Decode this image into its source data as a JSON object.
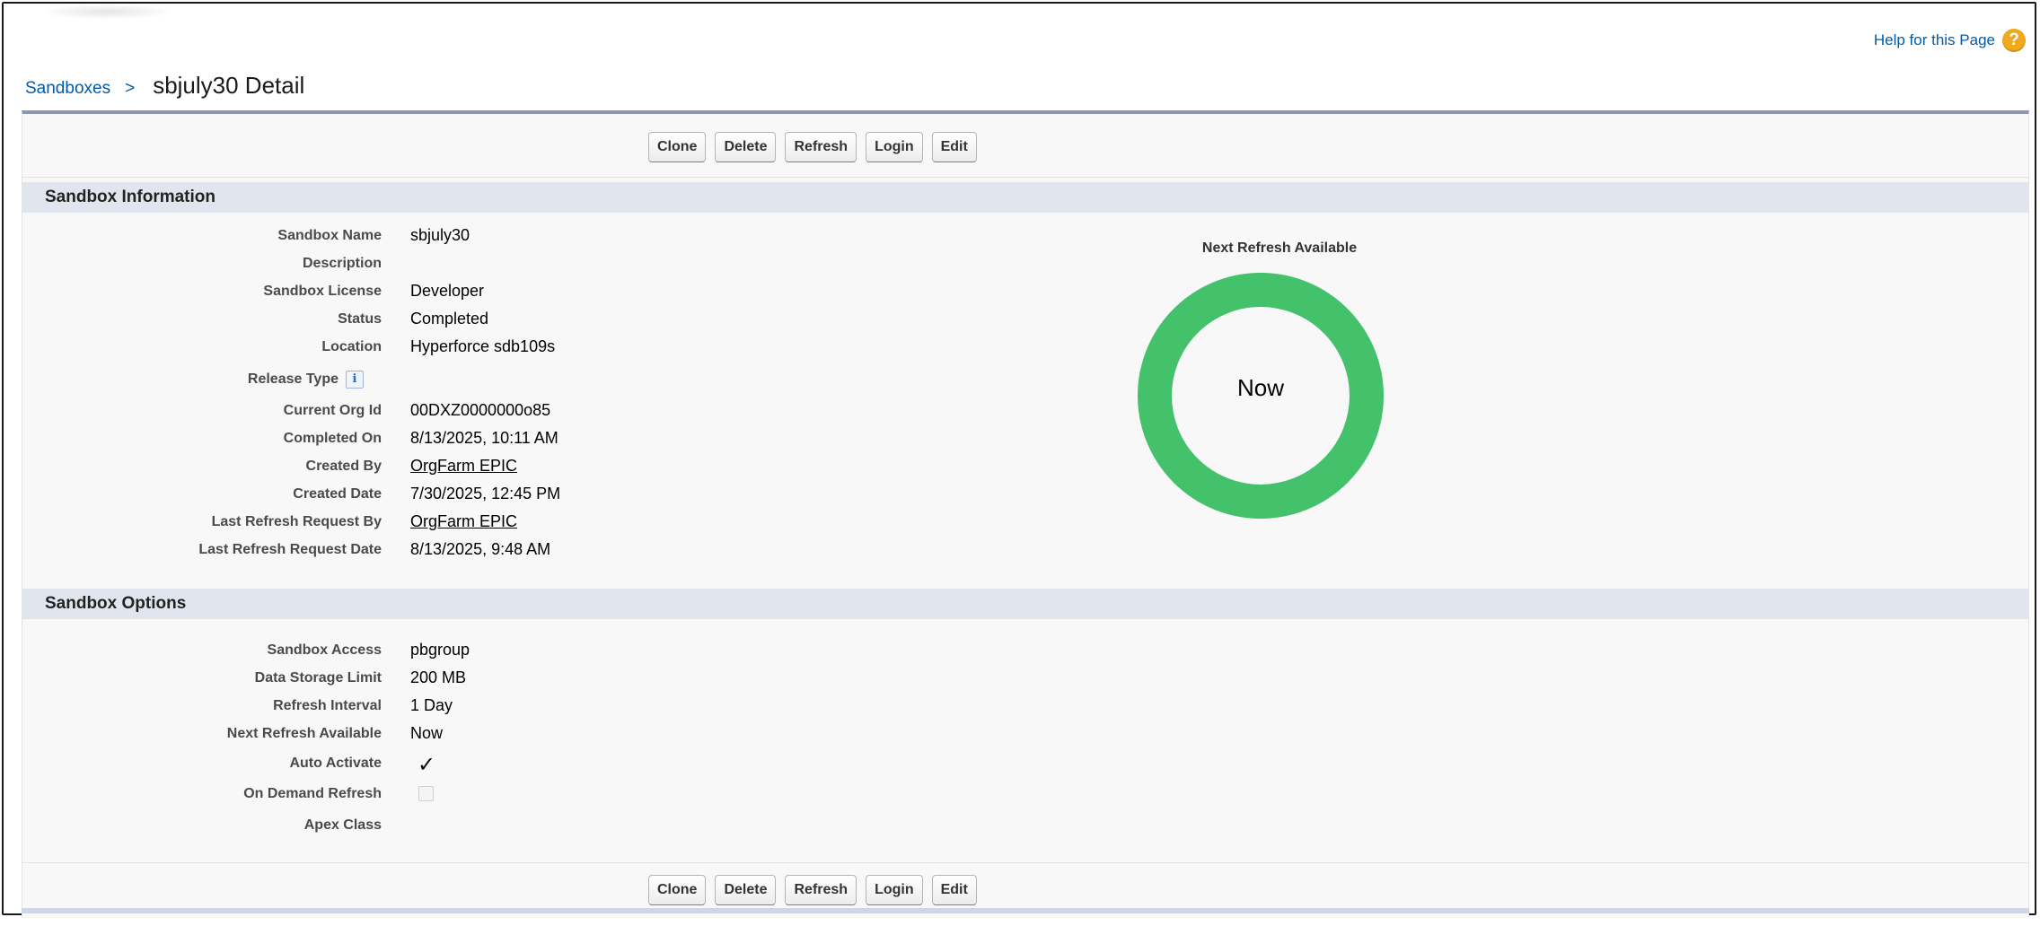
{
  "header": {
    "help_label": "Help for this Page",
    "help_icon": "question-icon",
    "breadcrumb": {
      "parent": "Sandboxes",
      "separator": ">"
    },
    "title": "sbjuly30 Detail"
  },
  "buttons": [
    "Clone",
    "Delete",
    "Refresh",
    "Login",
    "Edit"
  ],
  "sandbox_information": {
    "heading": "Sandbox Information",
    "fields": [
      {
        "label": "Sandbox Name",
        "value": "sbjuly30"
      },
      {
        "label": "Description",
        "value": ""
      },
      {
        "label": "Sandbox License",
        "value": "Developer"
      },
      {
        "label": "Status",
        "value": "Completed"
      },
      {
        "label": "Location",
        "value": "Hyperforce sdb109s"
      },
      {
        "label": "Release Type",
        "value": ""
      },
      {
        "label": "Current Org Id",
        "value": "00DXZ0000000o85"
      },
      {
        "label": "Completed On",
        "value": "8/13/2025, 10:11 AM"
      },
      {
        "label": "Created By",
        "value": "OrgFarm EPIC"
      },
      {
        "label": "Created Date",
        "value": "7/30/2025, 12:45 PM"
      },
      {
        "label": "Last Refresh Request By",
        "value": "OrgFarm EPIC"
      },
      {
        "label": "Last Refresh Request Date",
        "value": "8/13/2025, 9:48 AM"
      }
    ],
    "info_icon": "i"
  },
  "next_refresh_widget": {
    "title": "Next Refresh Available",
    "center_text": "Now",
    "progress": 1.0,
    "color": "#43c26b"
  },
  "sandbox_options": {
    "heading": "Sandbox Options",
    "fields": [
      {
        "label": "Sandbox Access",
        "value": "pbgroup"
      },
      {
        "label": "Data Storage Limit",
        "value": "200 MB"
      },
      {
        "label": "Refresh Interval",
        "value": "1 Day"
      },
      {
        "label": "Next Refresh Available",
        "value": "Now"
      },
      {
        "label": "Auto Activate",
        "checked": true
      },
      {
        "label": "On Demand Refresh",
        "checked": false
      },
      {
        "label": "Apex Class",
        "value": ""
      }
    ]
  },
  "colors": {
    "link": "#015ba7",
    "section_header_bg": "#e1e6ee",
    "panel_border": "#8c98ad",
    "help_icon": "#f0a81e"
  }
}
